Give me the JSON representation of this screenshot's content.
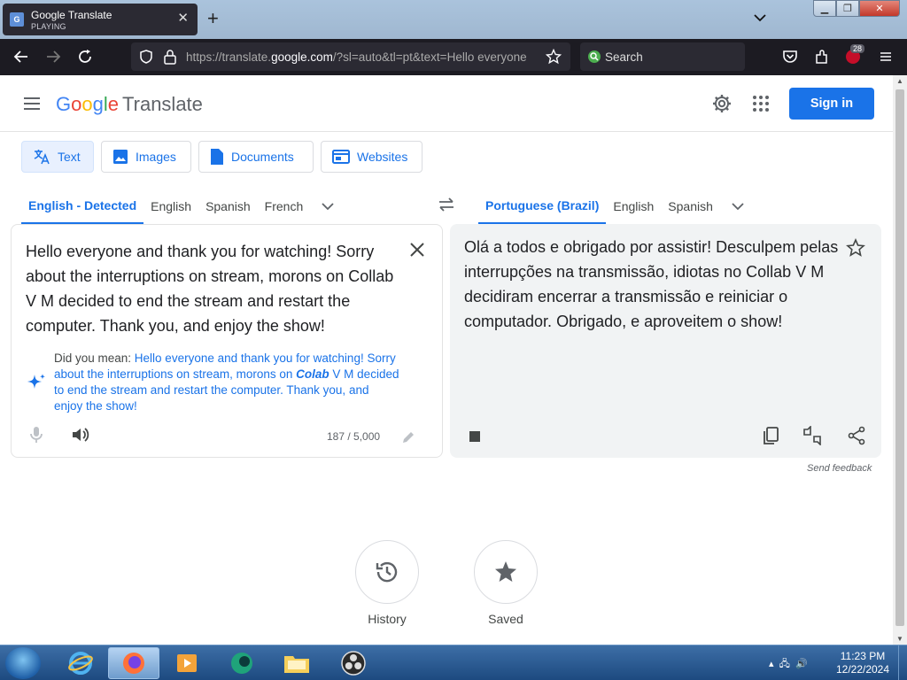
{
  "browser": {
    "tab_title": "Google Translate",
    "tab_status": "PLAYING",
    "favicon_label": "G",
    "url_prefix": "https://translate.",
    "url_domain": "google.com",
    "url_rest": "/?sl=auto&tl=pt&text=Hello everyone",
    "search_placeholder": "Search",
    "extension_badge": "28"
  },
  "header": {
    "logo_letters": [
      "G",
      "o",
      "o",
      "g",
      "l",
      "e"
    ],
    "product": "Translate",
    "signin_label": "Sign in"
  },
  "modes": [
    {
      "label": "Text",
      "icon": "translate-icon"
    },
    {
      "label": "Images",
      "icon": "image-icon"
    },
    {
      "label": "Documents",
      "icon": "document-icon"
    },
    {
      "label": "Websites",
      "icon": "website-icon"
    }
  ],
  "source_langs": [
    "English - Detected",
    "English",
    "Spanish",
    "French"
  ],
  "target_langs": [
    "Portuguese (Brazil)",
    "English",
    "Spanish"
  ],
  "source": {
    "text": "Hello everyone and thank you for watching! Sorry about the interruptions on stream, morons on Collab V M decided to end the stream and restart the computer. Thank you, and enjoy the show!",
    "did_you_mean_label": "Did you mean: ",
    "suggestion_before": "Hello everyone and thank you for watching! Sorry about the interruptions on stream, morons on ",
    "suggestion_fix": "Colab",
    "suggestion_after": " V M decided to end the stream and restart the computer. Thank you, and enjoy the show!",
    "char_count": "187 / 5,000"
  },
  "target": {
    "text": "Olá a todos e obrigado por assistir! Desculpem pelas interrupções na transmissão, idiotas no Collab V M decidiram encerrar a transmissão e reiniciar o computador. Obrigado, e aproveitem o show!"
  },
  "feedback_label": "Send feedback",
  "bottom": {
    "history_label": "History",
    "saved_label": "Saved"
  },
  "taskbar": {
    "time": "11:23 PM",
    "date": "12/22/2024"
  },
  "colors": {
    "accent": "#1a73e8",
    "target_bg": "#f1f3f4"
  }
}
